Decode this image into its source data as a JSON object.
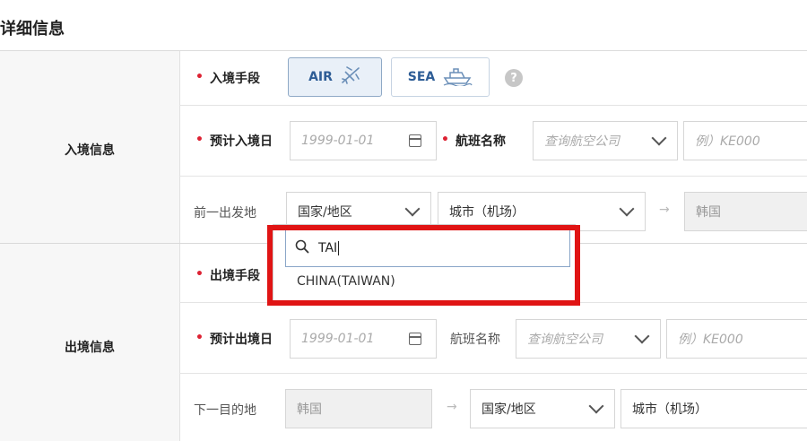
{
  "page": {
    "title": "详细信息"
  },
  "entry": {
    "section_label": "入境信息",
    "transport_label": "入境手段",
    "modes": [
      {
        "label": "AIR",
        "icon": "airplane-icon",
        "active": true
      },
      {
        "label": "SEA",
        "icon": "ship-icon",
        "active": false
      }
    ],
    "help_icon": "?",
    "date_label": "预计入境日",
    "date_placeholder": "1999-01-01",
    "flight_label": "航班名称",
    "airline_placeholder": "查询航空公司",
    "flight_placeholder": "例）KE000",
    "origin_label": "前一出发地",
    "country_select": "国家/地区",
    "city_select": "城市（机场）",
    "arrow": "→",
    "destination_value": "韩国"
  },
  "exit": {
    "section_label": "出境信息",
    "transport_label": "出境手段",
    "date_label": "预计出境日",
    "date_placeholder": "1999-01-01",
    "flight_label": "航班名称",
    "airline_placeholder": "查询航空公司",
    "flight_placeholder": "例）KE000",
    "next_label": "下一目的地",
    "origin_value": "韩国",
    "arrow": "→",
    "country_select": "国家/地区",
    "city_select": "城市（机场）"
  },
  "dropdown": {
    "search_value": "TAI",
    "options": [
      "CHINA(TAIWAN)"
    ]
  },
  "colors": {
    "highlight": "#e01414",
    "required": "#d22233",
    "mode_text": "#2e5d96"
  }
}
